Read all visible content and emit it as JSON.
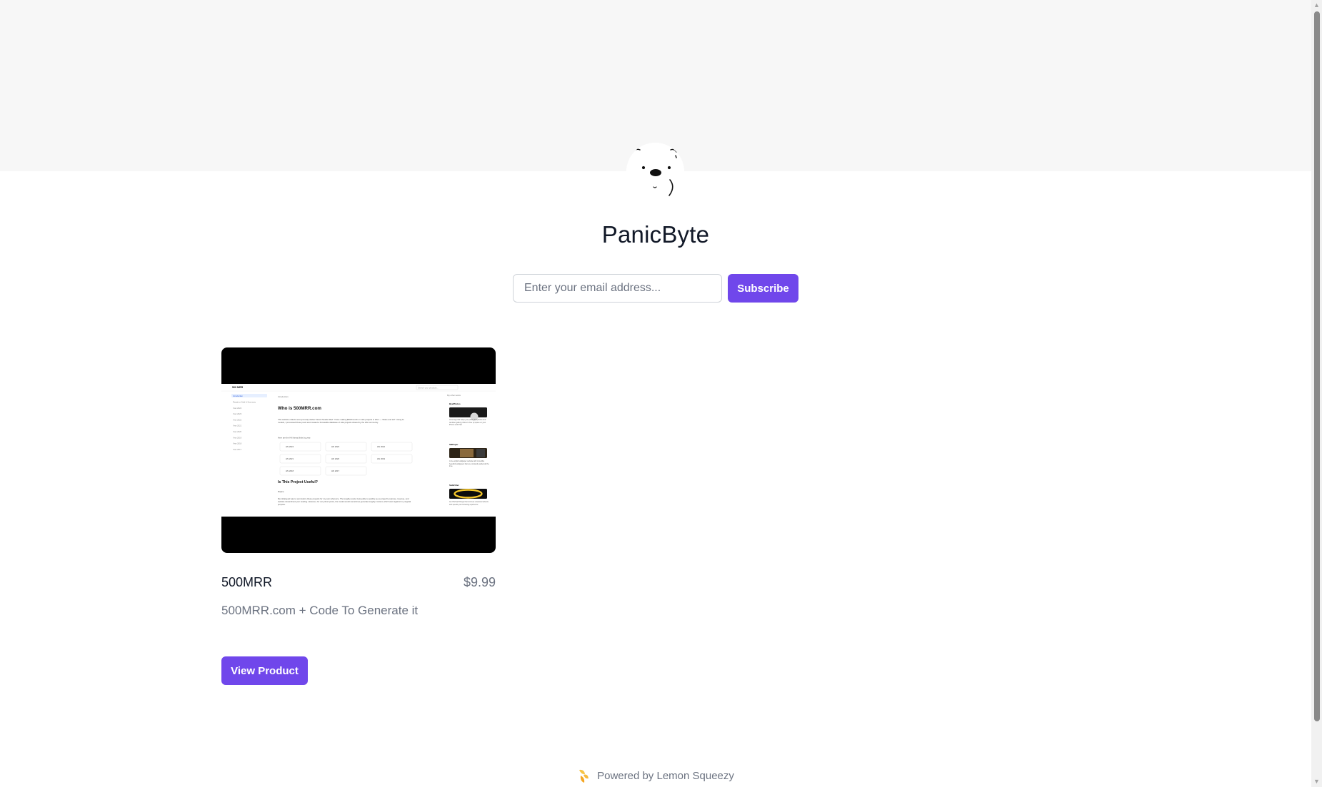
{
  "store": {
    "title": "PanicByte",
    "avatar_icon": "polar-bear-icon"
  },
  "subscribe": {
    "placeholder": "Enter your email address...",
    "button_label": "Subscribe"
  },
  "products": [
    {
      "name": "500MRR",
      "price": "$9.99",
      "description": "500MRR.com + Code To Generate it",
      "button_label": "View Product",
      "thumbnail": {
        "brand": "500 MRR",
        "search_placeholder": "Search your products...",
        "nav": [
          "Introduction",
          "Ready to Gold & Summary",
          "Year 2024",
          "Year 2023",
          "Year 2022",
          "Year 2021",
          "Year 2020",
          "Year 2019",
          "Year 2018",
          "Year 2017"
        ],
        "crumb": "Introduction",
        "heading": "Who is 500MRR.com",
        "paragraph": "This website collects anonymously Hacker News threads titled \"I have making $500/month on side projects in 20xx — Share and tell\". Using AI models, I processed these posts and created a browsable database of side projects shared by the HN community.",
        "paragraph2": "Here are the HN thread links by year:",
        "links": [
          "HN 2024",
          "HN 2023",
          "HN 2022",
          "HN 2021",
          "HN 2020",
          "HN 2019",
          "HN 2018",
          "HN 2017"
        ],
        "heading2": "Is This Project Useful?",
        "short": "Maybe.",
        "paragraph3": "My initial goal was to summarize these projects for my own reference. The lengthy posts, being able to quickly see a project's purpose, revenue, and website streamlined your reading. However, for very short posts, the model would sometimes generate lengthy content, which went against my original purpose.",
        "side_title": "My other works",
        "side_items": [
          {
            "name": "ByePhotos",
            "desc": "AI-Ad app that helps you quickly find photos and declutter gallery photos to free up space on your iPhone and iPad."
          },
          {
            "name": "SBPaper",
            "desc": "A free stylish wallpaper website with incredible beautiful wallpapers that are constantly added all the time."
          },
          {
            "name": "SafeFilter",
            "desc": "Au iOS/macOS app that removes unwanted adverts and speeds your browsing experience."
          }
        ]
      }
    }
  ],
  "footer": {
    "text": "Powered by Lemon Squeezy",
    "icon": "lemon-squeezy-icon"
  },
  "colors": {
    "accent": "#7047eb",
    "banner": "#f7f7f7",
    "muted_text": "#6b7280"
  }
}
